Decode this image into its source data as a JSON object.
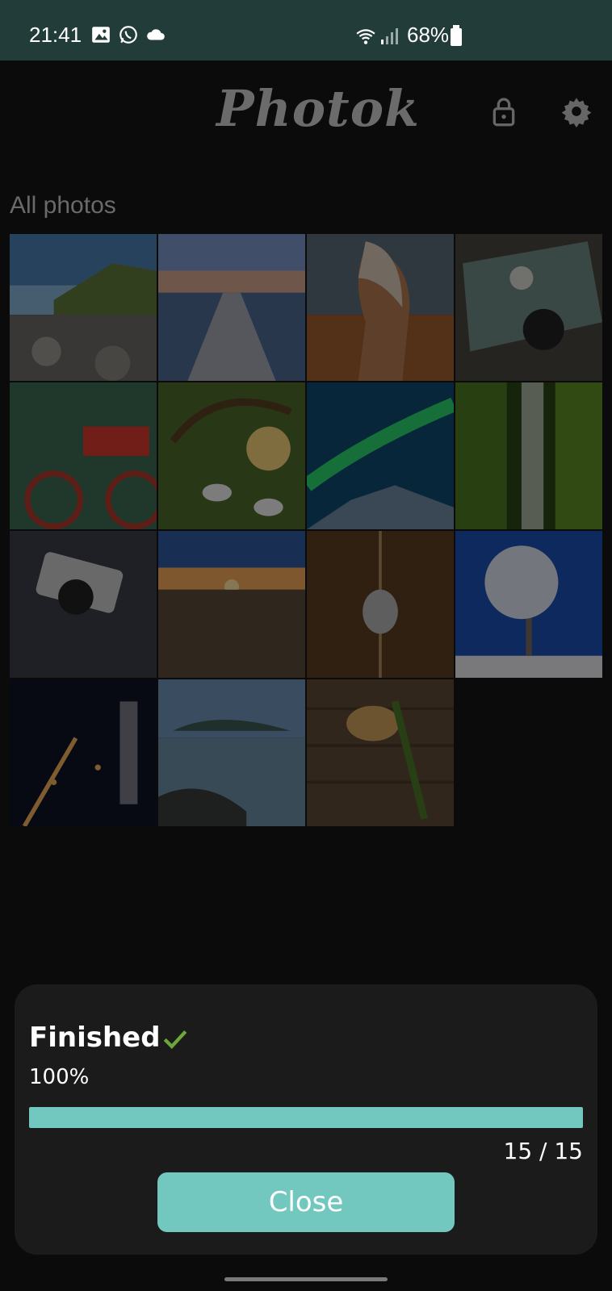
{
  "status_bar": {
    "time": "21:41",
    "battery": "68%",
    "icons": [
      "image-icon",
      "whatsapp-icon",
      "cloud-icon",
      "wifi-icon",
      "signal-icon",
      "battery-icon"
    ]
  },
  "header": {
    "app_title": "Photok",
    "icons": [
      "lock-icon",
      "settings-gear-icon"
    ]
  },
  "gallery": {
    "section_title": "All photos",
    "photos": [
      {
        "label": "coast-rocks"
      },
      {
        "label": "pier"
      },
      {
        "label": "horse"
      },
      {
        "label": "vintage-car"
      },
      {
        "label": "red-bicycle"
      },
      {
        "label": "calla-lilies"
      },
      {
        "label": "aurora"
      },
      {
        "label": "canyon"
      },
      {
        "label": "camera"
      },
      {
        "label": "sunset-sea"
      },
      {
        "label": "butterfly"
      },
      {
        "label": "frosted-tree"
      },
      {
        "label": "city-night"
      },
      {
        "label": "misty-coast"
      },
      {
        "label": "herbs-spoon"
      }
    ]
  },
  "progress_sheet": {
    "status": "Finished",
    "percent_text": "100%",
    "progress": 1.0,
    "count_text": "15 / 15",
    "close_label": "Close"
  },
  "colors": {
    "status_bar_bg": "#213c39",
    "accent": "#72c8bf",
    "check": "#6aa83a",
    "sheet_bg": "#1b1b1b",
    "background": "#0b0b0b"
  }
}
